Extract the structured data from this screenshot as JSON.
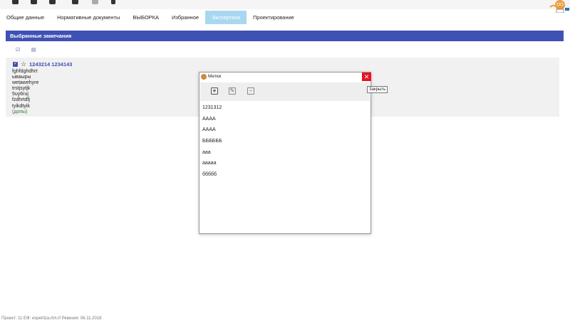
{
  "tabs": [
    {
      "label": "Общие данные"
    },
    {
      "label": "Нормативные документы"
    },
    {
      "label": "ВЫБОРКА"
    },
    {
      "label": "Избранное"
    },
    {
      "label": "Экспертиза"
    },
    {
      "label": "Проектирование"
    }
  ],
  "panel": {
    "title": "Выбранные замечания"
  },
  "remark": {
    "title": "1243214 1234143",
    "lines": [
      "fghfdghdhrt",
      "ываыры",
      "wetawehyre",
      "trstjsytjk",
      "5uy6ruj",
      "fzdhrtdfj",
      "tyikdtyik"
    ],
    "more": "(допы)"
  },
  "dialog": {
    "title": "Метки",
    "close_symbol": "✕",
    "close_tooltip": "Закрыть",
    "tags": [
      "1231312",
      "АААА",
      "АААА",
      "ББББББ",
      "ааа",
      "ааааа",
      "ббббб"
    ]
  },
  "footer": {
    "text": "Проект: 11     ЕФ: expertiza.rtm.rf     Ревизия: 06.11.2018"
  },
  "colors": {
    "accent": "#3f51b5",
    "active_tab": "#a9d7f1",
    "close": "#e81123",
    "more_link": "#2e7d32"
  }
}
